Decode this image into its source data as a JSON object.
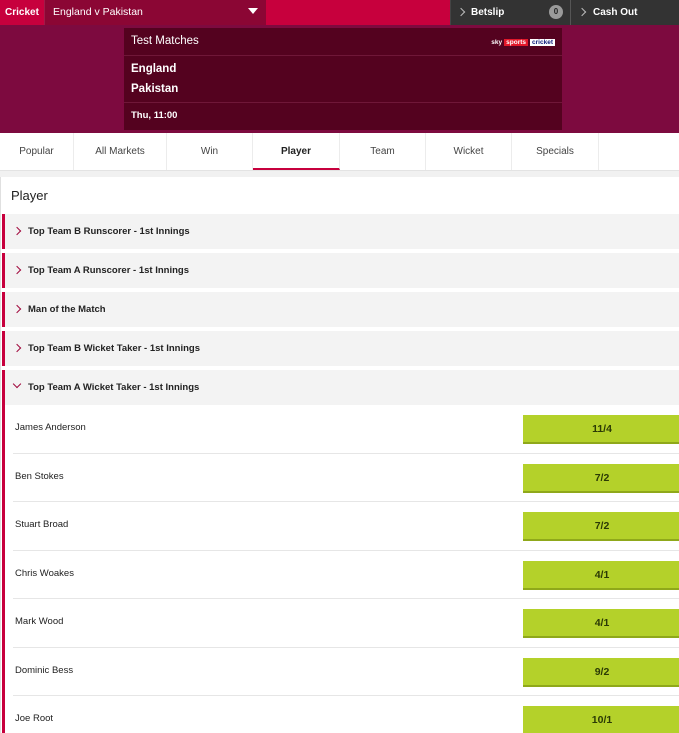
{
  "topbar": {
    "sport": "Cricket",
    "event": "England v Pakistan",
    "betslip_label": "Betslip",
    "betslip_count": "0",
    "cashout_label": "Cash Out"
  },
  "event": {
    "competition": "Test Matches",
    "logo": {
      "sky": "sky",
      "sports": "sports",
      "cricket": "cricket"
    },
    "team1": "England",
    "team2": "Pakistan",
    "start_time": "Thu, 11:00"
  },
  "tabs": [
    {
      "label": "Popular"
    },
    {
      "label": "All Markets"
    },
    {
      "label": "Win"
    },
    {
      "label": "Player"
    },
    {
      "label": "Team"
    },
    {
      "label": "Wicket"
    },
    {
      "label": "Specials"
    }
  ],
  "active_tab": "Player",
  "panel": {
    "title": "Player",
    "markets": [
      {
        "label": "Top Team B Runscorer - 1st Innings",
        "expanded": false
      },
      {
        "label": "Top Team A Runscorer - 1st Innings",
        "expanded": false
      },
      {
        "label": "Man of the Match",
        "expanded": false
      },
      {
        "label": "Top Team B Wicket Taker - 1st Innings",
        "expanded": false
      },
      {
        "label": "Top Team A Wicket Taker - 1st Innings",
        "expanded": true
      }
    ],
    "runners": [
      {
        "name": "James Anderson",
        "odds": "11/4"
      },
      {
        "name": "Ben Stokes",
        "odds": "7/2"
      },
      {
        "name": "Stuart Broad",
        "odds": "7/2"
      },
      {
        "name": "Chris Woakes",
        "odds": "4/1"
      },
      {
        "name": "Mark Wood",
        "odds": "4/1"
      },
      {
        "name": "Dominic Bess",
        "odds": "9/2"
      },
      {
        "name": "Joe Root",
        "odds": "10/1"
      }
    ]
  },
  "colors": {
    "brand": "#c7003d",
    "hero": "#7d0a3f",
    "odds_button": "#b4d12a"
  },
  "icons": [
    "chevron-right-icon",
    "chevron-down-icon",
    "dropdown-caret-icon"
  ]
}
